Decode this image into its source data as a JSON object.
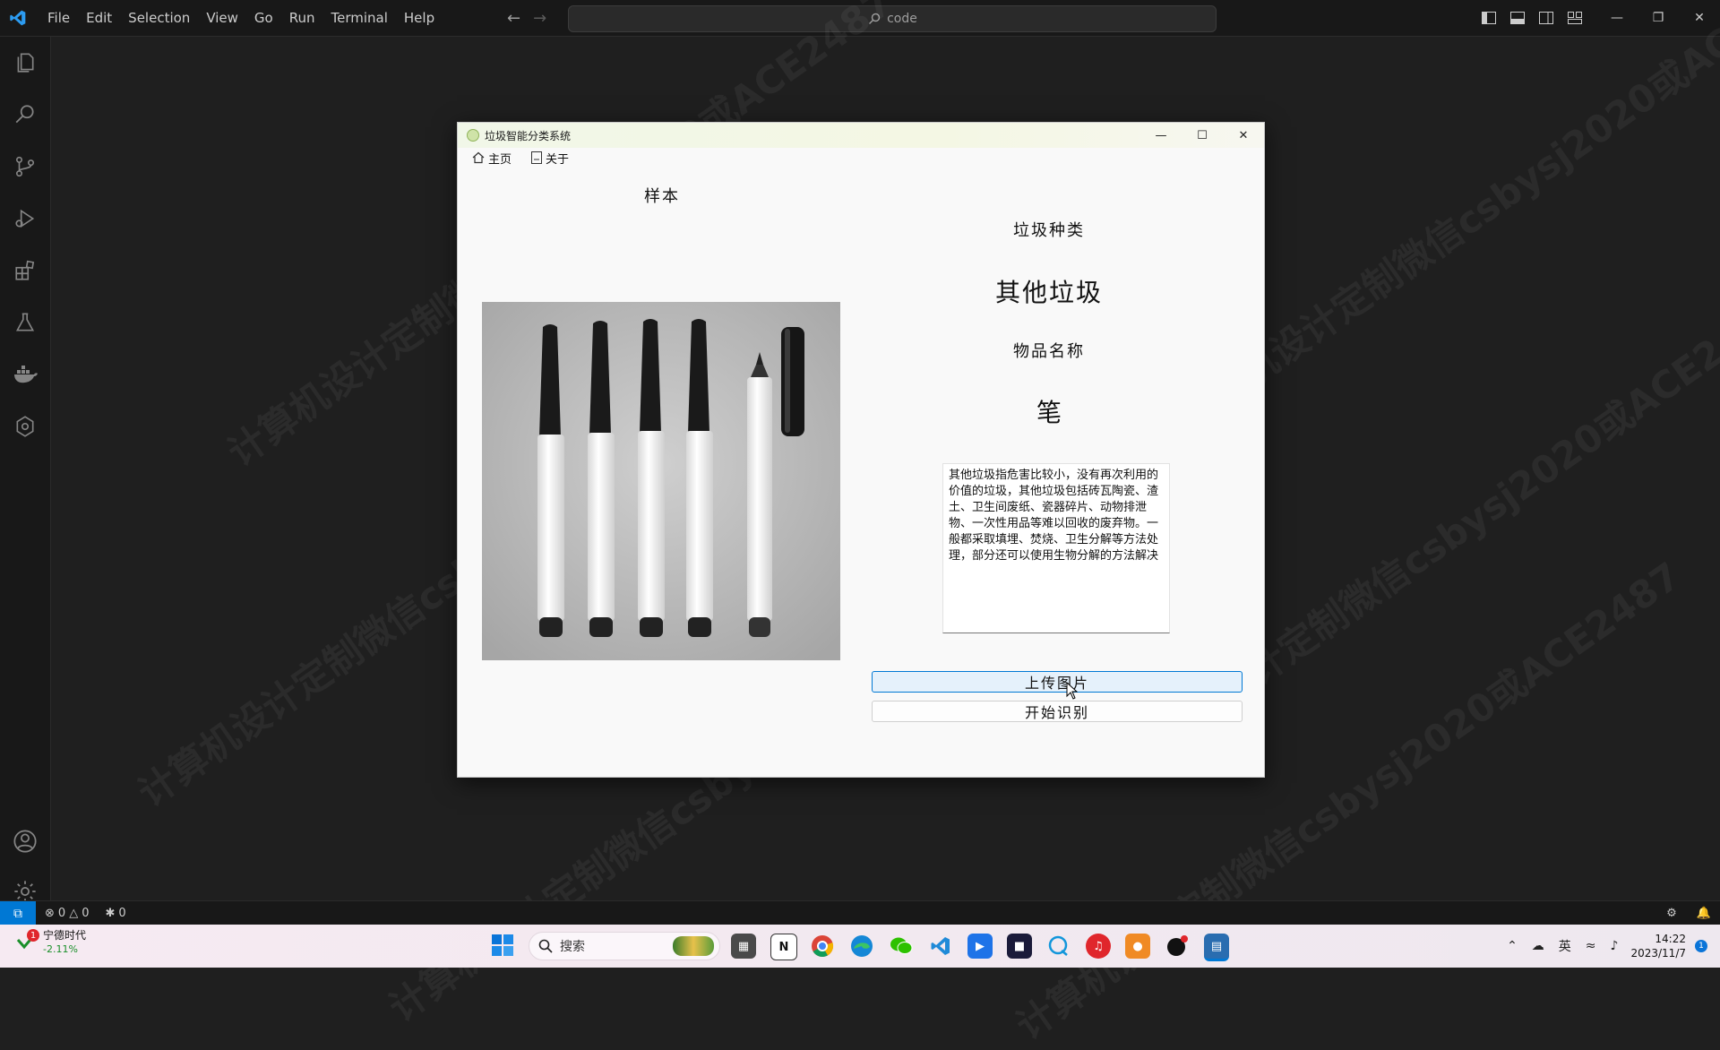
{
  "menu": [
    "File",
    "Edit",
    "Selection",
    "View",
    "Go",
    "Run",
    "Terminal",
    "Help"
  ],
  "search": {
    "text": "code"
  },
  "status": {
    "errors": "0",
    "warnings": "0",
    "ports": "0"
  },
  "watermark": "计算机设计定制微信csbysj2020或ACE2487",
  "app": {
    "title": "垃圾智能分类系统",
    "tabs": [
      {
        "label": "主页"
      },
      {
        "label": "关于"
      }
    ],
    "sample_label": "样本",
    "category_label": "垃圾种类",
    "category_value": "其他垃圾",
    "name_label": "物品名称",
    "name_value": "笔",
    "description": "其他垃圾指危害比较小，没有再次利用的价值的垃圾，其他垃圾包括砖瓦陶瓷、渣土、卫生间废纸、瓷器碎片、动物排泄物、一次性用品等难以回收的废弃物。一般都采取填埋、焚烧、卫生分解等方法处理，部分还可以使用生物分解的方法解决",
    "upload_button": "上传图片",
    "start_button": "开始识别"
  },
  "taskbar": {
    "stock_name": "宁德时代",
    "stock_change": "-2.11%",
    "stock_badge": "1",
    "search_placeholder": "搜索",
    "ime": "英",
    "time": "14:22",
    "date": "2023/11/7",
    "notification_count": "1"
  },
  "colors": {
    "accent": "#0078d4",
    "editor_bg": "#1f1f1f",
    "stock_down": "#1a8f2a"
  }
}
